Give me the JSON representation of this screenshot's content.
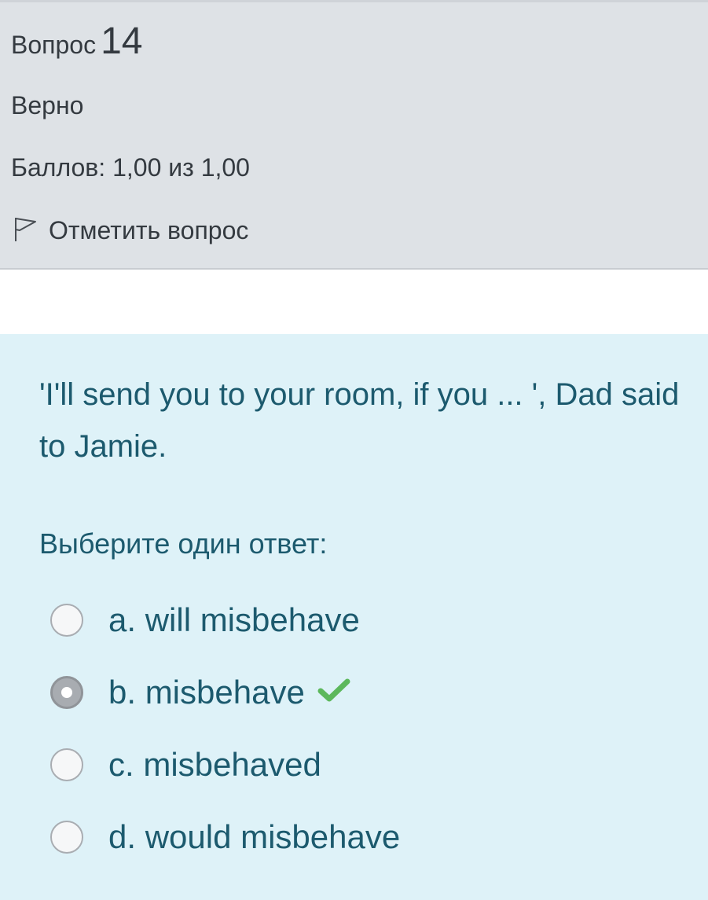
{
  "info": {
    "question_label": "Вопрос",
    "question_number": "14",
    "state": "Верно",
    "grade": "Баллов: 1,00 из 1,00",
    "flag_label": "Отметить вопрос",
    "flag_icon": "flag-icon"
  },
  "question": {
    "text": "'I'll send you to your room, if you ... ', Dad said to Jamie.",
    "prompt": "Выберите один ответ:",
    "options": [
      {
        "label": "a. will misbehave",
        "selected": false
      },
      {
        "label": "b. misbehave",
        "selected": true,
        "correct": true
      },
      {
        "label": "c. misbehaved",
        "selected": false
      },
      {
        "label": "d. would misbehave",
        "selected": false
      }
    ],
    "correct_icon": "checkmark-icon"
  },
  "colors": {
    "info_background": "#dee2e6",
    "content_background": "#def2f8",
    "text": "#1c5a6e",
    "correct": "#5cb85c"
  }
}
